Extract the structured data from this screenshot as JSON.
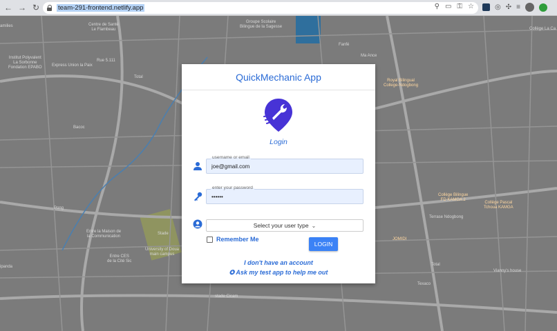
{
  "browser": {
    "url": "team-291-frontend.netlify.app"
  },
  "map": {
    "pois": [
      {
        "label": "amilies"
      },
      {
        "label": "Centre de Santé\nLe Flambeau"
      },
      {
        "label": "Groupe Scolaire\nBilingue de la Sagesse"
      },
      {
        "label": "Fanfé"
      },
      {
        "label": "Ma Ance"
      },
      {
        "label": "Collège La Ca"
      },
      {
        "label": "Institut Polyvalent\nLa Sorbonne\nFondation EPABO"
      },
      {
        "label": "Express Union la Paix"
      },
      {
        "label": "Rue 5.111"
      },
      {
        "label": "Total"
      },
      {
        "label": "Royal Bilingual\nCollege-Ndogbong"
      },
      {
        "label": "Bacoc"
      },
      {
        "label": "Collège Bilingue\nFD KAMGA 2"
      },
      {
        "label": "Collège Pascal\nTchoua KAMGA"
      },
      {
        "label": "Pong"
      },
      {
        "label": "Terrase Ndogbong"
      },
      {
        "label": "Entre la Maison de\nla Communication"
      },
      {
        "label": "Stade"
      },
      {
        "label": "University of Doua\nmain campus"
      },
      {
        "label": "JOMIDI"
      },
      {
        "label": "Entre CES\nde la Cité Sic"
      },
      {
        "label": "Total"
      },
      {
        "label": "Vianny's house"
      },
      {
        "label": "ipanda"
      },
      {
        "label": "Texaco"
      },
      {
        "label": "stade Cicam"
      }
    ]
  },
  "card": {
    "title": "QuickMechanic App",
    "heading": "Login",
    "username_label": "username or email",
    "username_value": "joe@gmail.com",
    "password_label": "enter your password",
    "password_value": "••••••",
    "user_type_placeholder": "Select your user type",
    "remember_label": "Remember Me",
    "login_button": "LOGIN",
    "no_account_link": "I don't have an account",
    "test_app_link": "✪ Ask my test app to help me out"
  },
  "colors": {
    "accent": "#2a6bd6",
    "logo": "#4733d6",
    "button": "#3b82f6"
  }
}
